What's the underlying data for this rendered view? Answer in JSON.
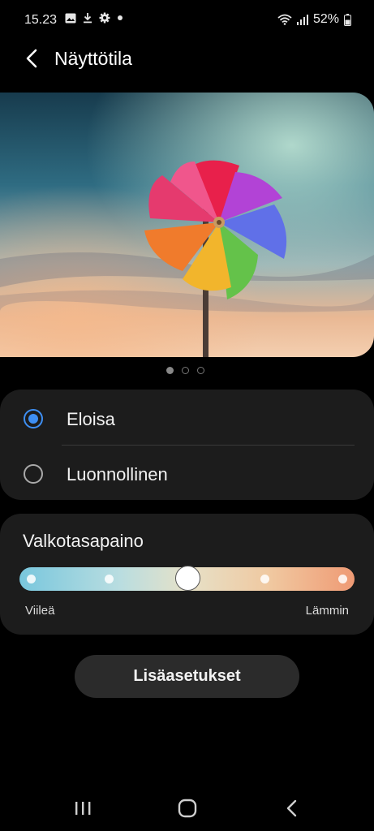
{
  "status_bar": {
    "time": "15.23",
    "battery": "52%",
    "icons_left": [
      "image-icon",
      "download-icon",
      "gear-icon",
      "dot-icon"
    ],
    "icons_right": [
      "wifi-icon",
      "signal-icon",
      "battery-icon"
    ]
  },
  "header": {
    "title": "Näyttötila",
    "back_icon": "chevron-left-icon"
  },
  "preview": {
    "pages": 3,
    "current_page": 1
  },
  "screen_mode": {
    "options": [
      {
        "label": "Eloisa",
        "selected": true
      },
      {
        "label": "Luonnollinen",
        "selected": false
      }
    ]
  },
  "white_balance": {
    "title": "Valkotasapaino",
    "min_label": "Viileä",
    "max_label": "Lämmin",
    "steps": 5,
    "value": 3
  },
  "advanced_button": {
    "label": "Lisäasetukset"
  },
  "nav_bar": {
    "items": [
      "recents-icon",
      "home-icon",
      "back-icon"
    ]
  },
  "colors": {
    "accent": "#3e8ff3",
    "card_bg": "#1c1c1c",
    "button_bg": "#2b2b2b"
  }
}
